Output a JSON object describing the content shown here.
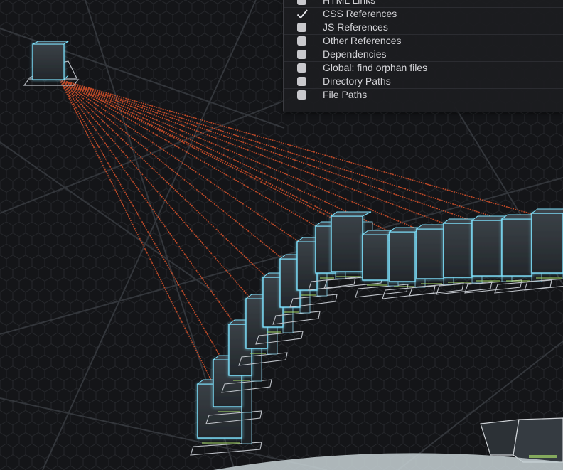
{
  "options_panel": {
    "items": [
      {
        "label": "HTML Links",
        "checked": false
      },
      {
        "label": "CSS References",
        "checked": true
      },
      {
        "label": "JS References",
        "checked": false
      },
      {
        "label": "Other References",
        "checked": false
      },
      {
        "label": "Dependencies",
        "checked": false
      },
      {
        "label": "Global: find orphan files",
        "checked": false
      },
      {
        "label": "Directory Paths",
        "checked": false
      },
      {
        "label": "File Paths",
        "checked": false
      }
    ]
  },
  "colors": {
    "background": "#141518",
    "hex_grid": "#2a2c31",
    "box_glow": "#7fe3ff",
    "box_face": "#2c3136",
    "reference_line": "#d2502a",
    "panel_bg": "#1c1d20",
    "panel_text": "#d4d4d8"
  },
  "icons": {
    "checkmark": "checkmark-icon",
    "unchecked": "checkbox-unchecked"
  }
}
